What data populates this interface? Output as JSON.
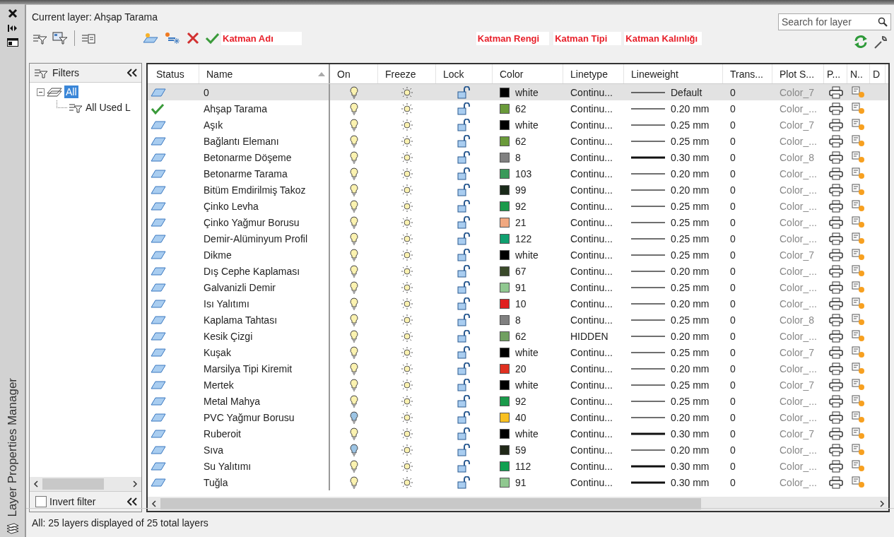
{
  "palette_title": "Layer Properties Manager",
  "current_layer": "Current layer: Ahşap Tarama",
  "search": {
    "placeholder": "Search for layer"
  },
  "annotations": [
    "Katman Adı",
    "Katman Rengi",
    "Katman Tipi",
    "Katman Kalınlığı"
  ],
  "filters": {
    "title": "Filters",
    "tree": [
      {
        "label": "All",
        "selected": true,
        "expanded": true,
        "children": [
          {
            "label": "All Used L",
            "selected": false
          }
        ]
      }
    ],
    "invert_filter": {
      "label": "Invert filter",
      "checked": false
    }
  },
  "columns": [
    "Status",
    "Name",
    "On",
    "Freeze",
    "Lock",
    "Color",
    "Linetype",
    "Lineweight",
    "Trans...",
    "Plot S...",
    "P...",
    "N..",
    "D"
  ],
  "rows": [
    {
      "name": "0",
      "selected": true,
      "current": false,
      "on": true,
      "color": "#000000",
      "color_name": "white",
      "linetype": "Continu...",
      "kind": "thin",
      "lineweight": "Default",
      "transparency": "0",
      "plot_style": "Color_7"
    },
    {
      "name": "Ahşap Tarama",
      "selected": false,
      "current": true,
      "on": true,
      "color": "#6a9a3a",
      "color_name": "62",
      "linetype": "Continu...",
      "kind": "thin",
      "lineweight": "0.20 mm",
      "transparency": "0",
      "plot_style": "Color_..."
    },
    {
      "name": "Aşık",
      "selected": false,
      "current": false,
      "on": true,
      "color": "#000000",
      "color_name": "white",
      "linetype": "Continu...",
      "kind": "thin",
      "lineweight": "0.25 mm",
      "transparency": "0",
      "plot_style": "Color_7"
    },
    {
      "name": "Bağlantı Elemanı",
      "selected": false,
      "current": false,
      "on": true,
      "color": "#6a9a3a",
      "color_name": "62",
      "linetype": "Continu...",
      "kind": "thin",
      "lineweight": "0.25 mm",
      "transparency": "0",
      "plot_style": "Color_..."
    },
    {
      "name": "Betonarme Döşeme",
      "selected": false,
      "current": false,
      "on": true,
      "color": "#808080",
      "color_name": "8",
      "linetype": "Continu...",
      "kind": "thick",
      "lineweight": "0.30 mm",
      "transparency": "0",
      "plot_style": "Color_8"
    },
    {
      "name": "Betonarme Tarama",
      "selected": false,
      "current": false,
      "on": true,
      "color": "#3a9a5a",
      "color_name": "103",
      "linetype": "Continu...",
      "kind": "thin",
      "lineweight": "0.20 mm",
      "transparency": "0",
      "plot_style": "Color_..."
    },
    {
      "name": "Bitüm Emdirilmiş Takoz",
      "selected": false,
      "current": false,
      "on": true,
      "color": "#1a2a1a",
      "color_name": "99",
      "linetype": "Continu...",
      "kind": "thin",
      "lineweight": "0.20 mm",
      "transparency": "0",
      "plot_style": "Color_..."
    },
    {
      "name": "Çinko Levha",
      "selected": false,
      "current": false,
      "on": true,
      "color": "#1a9a4a",
      "color_name": "92",
      "linetype": "Continu...",
      "kind": "thin",
      "lineweight": "0.25 mm",
      "transparency": "0",
      "plot_style": "Color_..."
    },
    {
      "name": "Çinko Yağmur Borusu",
      "selected": false,
      "current": false,
      "on": true,
      "color": "#f0a880",
      "color_name": "21",
      "linetype": "Continu...",
      "kind": "thin",
      "lineweight": "0.25 mm",
      "transparency": "0",
      "plot_style": "Color_..."
    },
    {
      "name": "Demir-Alüminyum Profil",
      "selected": false,
      "current": false,
      "on": true,
      "color": "#10a070",
      "color_name": "122",
      "linetype": "Continu...",
      "kind": "thin",
      "lineweight": "0.25 mm",
      "transparency": "0",
      "plot_style": "Color_..."
    },
    {
      "name": "Dikme",
      "selected": false,
      "current": false,
      "on": true,
      "color": "#000000",
      "color_name": "white",
      "linetype": "Continu...",
      "kind": "thin",
      "lineweight": "0.25 mm",
      "transparency": "0",
      "plot_style": "Color_7"
    },
    {
      "name": "Dış Cephe Kaplaması",
      "selected": false,
      "current": false,
      "on": true,
      "color": "#3a4a2a",
      "color_name": "67",
      "linetype": "Continu...",
      "kind": "thin",
      "lineweight": "0.20 mm",
      "transparency": "0",
      "plot_style": "Color_..."
    },
    {
      "name": "Galvanizli Demir",
      "selected": false,
      "current": false,
      "on": true,
      "color": "#90c890",
      "color_name": "91",
      "linetype": "Continu...",
      "kind": "thin",
      "lineweight": "0.25 mm",
      "transparency": "0",
      "plot_style": "Color_..."
    },
    {
      "name": "Isı Yalıtımı",
      "selected": false,
      "current": false,
      "on": true,
      "color": "#e02020",
      "color_name": "10",
      "linetype": "Continu...",
      "kind": "thin",
      "lineweight": "0.20 mm",
      "transparency": "0",
      "plot_style": "Color_..."
    },
    {
      "name": "Kaplama Tahtası",
      "selected": false,
      "current": false,
      "on": true,
      "color": "#808080",
      "color_name": "8",
      "linetype": "Continu...",
      "kind": "thin",
      "lineweight": "0.25 mm",
      "transparency": "0",
      "plot_style": "Color_8"
    },
    {
      "name": "Kesik Çizgi",
      "selected": false,
      "current": false,
      "on": true,
      "color": "#70a060",
      "color_name": "62",
      "linetype": "HIDDEN",
      "kind": "thin",
      "lineweight": "0.20 mm",
      "transparency": "0",
      "plot_style": "Color_..."
    },
    {
      "name": "Kuşak",
      "selected": false,
      "current": false,
      "on": true,
      "color": "#000000",
      "color_name": "white",
      "linetype": "Continu...",
      "kind": "thin",
      "lineweight": "0.25 mm",
      "transparency": "0",
      "plot_style": "Color_7"
    },
    {
      "name": "Marsilya Tipi Kiremit",
      "selected": false,
      "current": false,
      "on": true,
      "color": "#e03020",
      "color_name": "20",
      "linetype": "Continu...",
      "kind": "thin",
      "lineweight": "0.20 mm",
      "transparency": "0",
      "plot_style": "Color_..."
    },
    {
      "name": "Mertek",
      "selected": false,
      "current": false,
      "on": true,
      "color": "#000000",
      "color_name": "white",
      "linetype": "Continu...",
      "kind": "thin",
      "lineweight": "0.25 mm",
      "transparency": "0",
      "plot_style": "Color_7"
    },
    {
      "name": "Metal Mahya",
      "selected": false,
      "current": false,
      "on": true,
      "color": "#1a9a4a",
      "color_name": "92",
      "linetype": "Continu...",
      "kind": "thin",
      "lineweight": "0.25 mm",
      "transparency": "0",
      "plot_style": "Color_..."
    },
    {
      "name": "PVC Yağmur Borusu",
      "selected": false,
      "current": false,
      "on": false,
      "color": "#f8c020",
      "color_name": "40",
      "linetype": "Continu...",
      "kind": "thin",
      "lineweight": "0.20 mm",
      "transparency": "0",
      "plot_style": "Color_..."
    },
    {
      "name": "Ruberoit",
      "selected": false,
      "current": false,
      "on": true,
      "color": "#000000",
      "color_name": "white",
      "linetype": "Continu...",
      "kind": "thick",
      "lineweight": "0.30 mm",
      "transparency": "0",
      "plot_style": "Color_7"
    },
    {
      "name": "Sıva",
      "selected": false,
      "current": false,
      "on": false,
      "color": "#202818",
      "color_name": "59",
      "linetype": "Continu...",
      "kind": "thin",
      "lineweight": "0.20 mm",
      "transparency": "0",
      "plot_style": "Color_..."
    },
    {
      "name": "Su Yalıtımı",
      "selected": false,
      "current": false,
      "on": true,
      "color": "#10a050",
      "color_name": "112",
      "linetype": "Continu...",
      "kind": "thick",
      "lineweight": "0.30 mm",
      "transparency": "0",
      "plot_style": "Color_..."
    },
    {
      "name": "Tuğla",
      "selected": false,
      "current": false,
      "on": true,
      "color": "#90c890",
      "color_name": "91",
      "linetype": "Continu...",
      "kind": "thick",
      "lineweight": "0.30 mm",
      "transparency": "0",
      "plot_style": "Color_..."
    }
  ],
  "status_bar": "All: 25 layers displayed of 25 total layers"
}
